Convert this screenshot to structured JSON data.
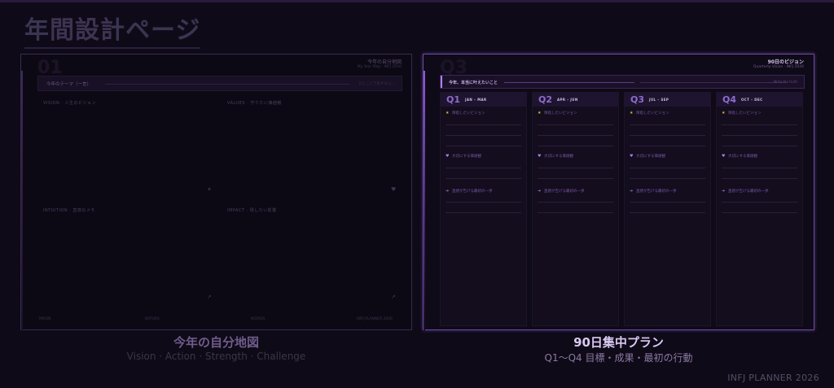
{
  "page": {
    "title": "年間設計ページ",
    "brand": "INFJ PLANNER 2026"
  },
  "left_panel": {
    "title": "今年の自分地図",
    "subtitle": "My Year Map · INFJ 2026",
    "ghost": "01",
    "theme_label": "今年のテーマ（一言）",
    "theme_placeholder": "ひとことで表すなら…",
    "quadrants": [
      {
        "label": "VISION · 人生のビジョン",
        "icon": "✦"
      },
      {
        "label": "VALUES · 守りたい価値観",
        "icon": "♥"
      },
      {
        "label": "INTUITION · 直感のメモ",
        "icon": "↗"
      },
      {
        "label": "IMPACT · 残したい影響",
        "icon": "↗"
      }
    ],
    "footer": [
      "MOON",
      "NATURE",
      "WORDS",
      "INFJ PLANNER 2026"
    ]
  },
  "right_panel": {
    "title": "90日のビジョン",
    "subtitle": "Quarterly Vision · INFJ 2026",
    "ghost": "Q3",
    "goal_label": "今年、本当に叶えたいこと",
    "goal_placeholder": "Write the truth",
    "quarters": [
      {
        "num": "Q1",
        "range": "JAN – MAR"
      },
      {
        "num": "Q2",
        "range": "APR – JUN"
      },
      {
        "num": "Q3",
        "range": "JUL – SEP"
      },
      {
        "num": "Q4",
        "range": "OCT – DEC"
      }
    ],
    "sections": [
      {
        "icon": "★",
        "label": "目指したいビジョン"
      },
      {
        "icon": "♥",
        "label": "大切にする価値観"
      },
      {
        "icon": "➔",
        "label": "直感が告げる最初の一歩"
      }
    ]
  },
  "captions": {
    "left": {
      "main": "今年の自分地図",
      "sub": "Vision · Action · Strength · Challenge"
    },
    "right": {
      "main": "90日集中プラン",
      "sub": "Q1〜Q4 目標・成果・最初の行動"
    }
  },
  "colors": {
    "background": "#0f0a17",
    "accent": "#8a5cd6",
    "star": "#d6b848"
  }
}
